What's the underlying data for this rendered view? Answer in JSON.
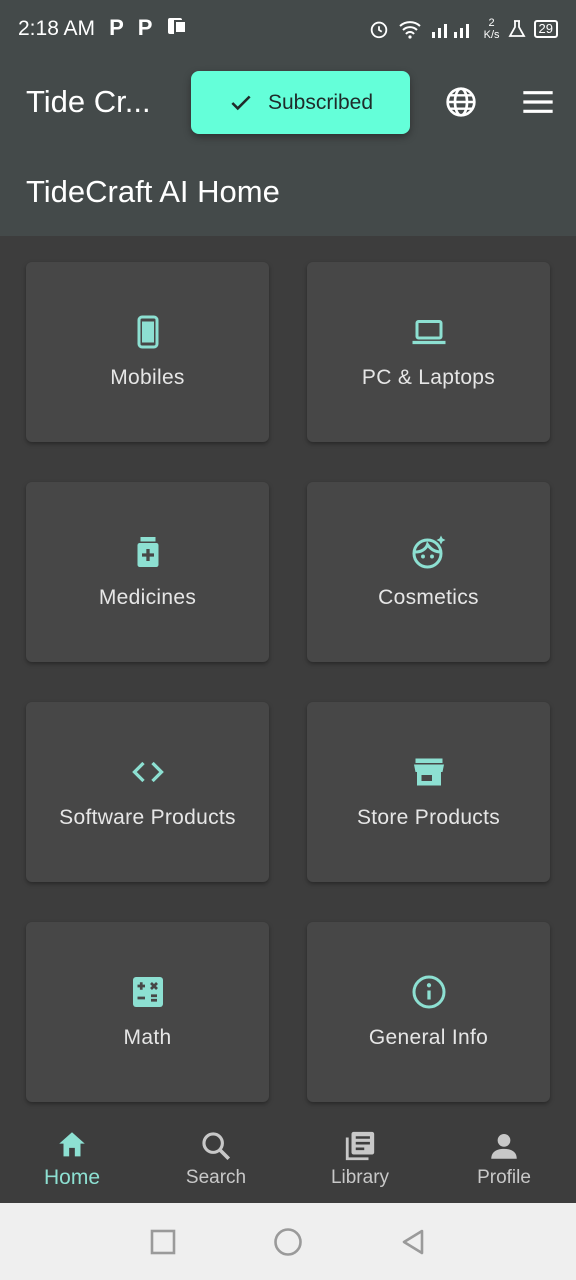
{
  "status": {
    "time": "2:18 AM",
    "left_icons": [
      "P",
      "P"
    ],
    "net_speed_top": "2",
    "net_speed_bottom": "K/s",
    "battery": "29"
  },
  "header": {
    "app_title": "Tide Cr...",
    "subscribed_label": "Subscribed",
    "globe_icon": "globe-icon",
    "menu_icon": "menu-icon",
    "page_title": "TideCraft AI Home"
  },
  "categories": [
    {
      "label": "Mobiles",
      "icon": "smartphone-icon"
    },
    {
      "label": "PC & Laptops",
      "icon": "laptop-icon"
    },
    {
      "label": "Medicines",
      "icon": "medication-icon"
    },
    {
      "label": "Cosmetics",
      "icon": "face-sparkle-icon"
    },
    {
      "label": "Software Products",
      "icon": "code-icon"
    },
    {
      "label": "Store Products",
      "icon": "storefront-icon"
    },
    {
      "label": "Math",
      "icon": "calculator-icon"
    },
    {
      "label": "General Info",
      "icon": "info-icon"
    }
  ],
  "bottom_nav": [
    {
      "label": "Home",
      "icon": "home-icon",
      "active": true
    },
    {
      "label": "Search",
      "icon": "search-icon",
      "active": false
    },
    {
      "label": "Library",
      "icon": "library-icon",
      "active": false
    },
    {
      "label": "Profile",
      "icon": "person-icon",
      "active": false
    }
  ],
  "colors": {
    "accent": "#64ffd9",
    "icon_teal": "#8de0d2",
    "app_bar": "#444a4a",
    "background": "#3d3d3d",
    "card": "#474747"
  }
}
